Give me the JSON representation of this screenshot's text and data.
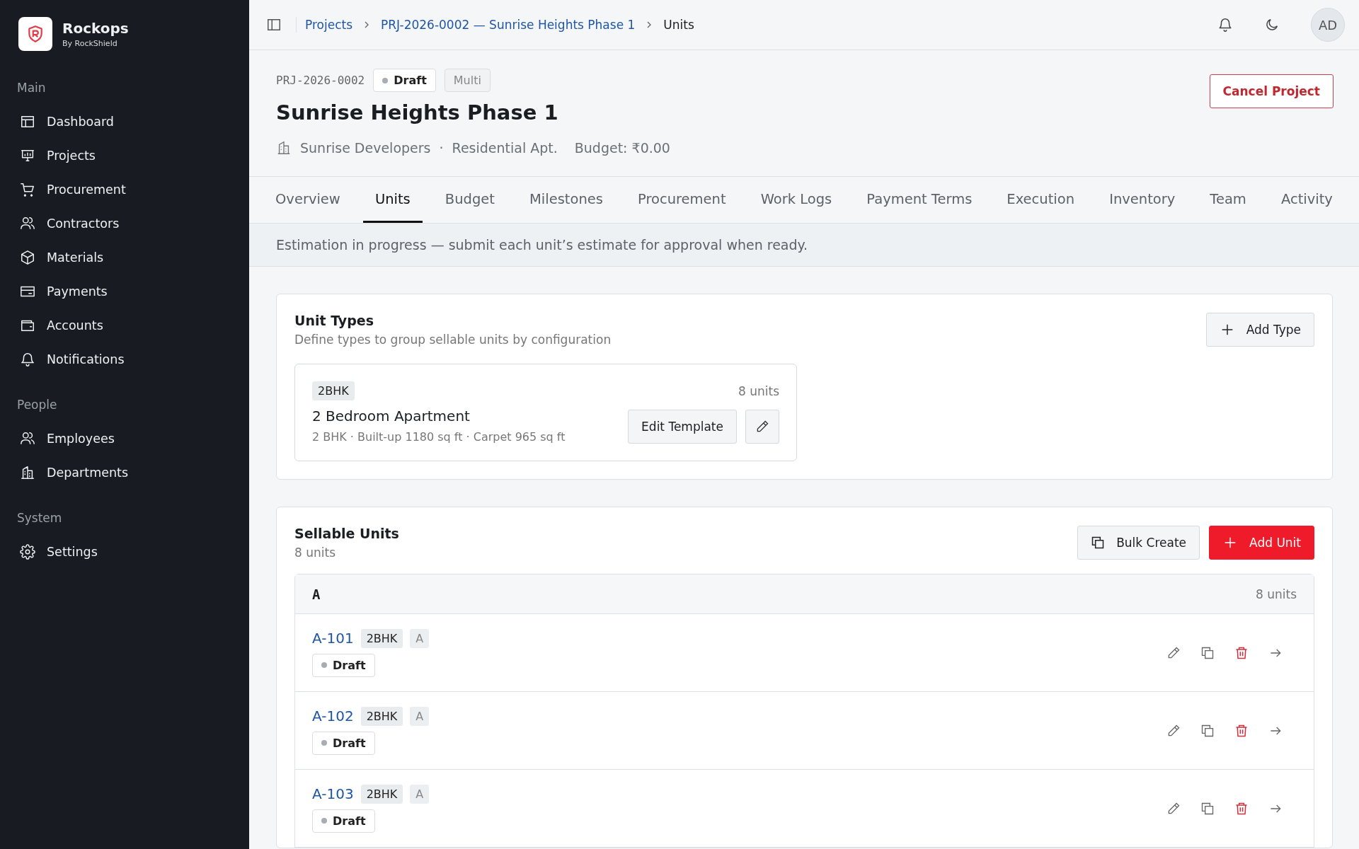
{
  "brand": {
    "name": "Rockops",
    "tagline": "By RockShield"
  },
  "sidebar": {
    "sections": [
      {
        "heading": "Main",
        "items": [
          {
            "label": "Dashboard",
            "selected": false
          },
          {
            "label": "Projects",
            "selected": false
          },
          {
            "label": "Procurement",
            "selected": false
          },
          {
            "label": "Contractors",
            "selected": false
          },
          {
            "label": "Materials",
            "selected": false
          },
          {
            "label": "Payments",
            "selected": false
          },
          {
            "label": "Accounts",
            "selected": false
          },
          {
            "label": "Notifications",
            "selected": false
          }
        ]
      },
      {
        "heading": "People",
        "items": [
          {
            "label": "Employees",
            "selected": false
          },
          {
            "label": "Departments",
            "selected": false
          }
        ]
      },
      {
        "heading": "System",
        "items": [
          {
            "label": "Settings",
            "selected": false
          }
        ]
      }
    ]
  },
  "breadcrumbs": [
    {
      "label": "Projects",
      "kind": "link"
    },
    {
      "label": "PRJ-2026-0002 — Sunrise Heights Phase 1",
      "kind": "link"
    },
    {
      "label": "Units",
      "kind": "current"
    }
  ],
  "user": {
    "initials": "AD"
  },
  "project": {
    "code": "PRJ-2026-0002",
    "status": "Draft",
    "type": "Multi",
    "title": "Sunrise Heights Phase 1",
    "developer": "Sunrise Developers",
    "separator": "·",
    "category": "Residential Apt.",
    "budget": "Budget: ₹0.00",
    "action": "Cancel Project"
  },
  "tabs": [
    {
      "label": "Overview",
      "selected": false
    },
    {
      "label": "Units",
      "selected": true
    },
    {
      "label": "Budget",
      "selected": false
    },
    {
      "label": "Milestones",
      "selected": false
    },
    {
      "label": "Procurement",
      "selected": false
    },
    {
      "label": "Work Logs",
      "selected": false
    },
    {
      "label": "Payment Terms",
      "selected": false
    },
    {
      "label": "Execution",
      "selected": false
    },
    {
      "label": "Inventory",
      "selected": false
    },
    {
      "label": "Team",
      "selected": false
    },
    {
      "label": "Activity",
      "selected": false
    }
  ],
  "banner": "Estimation in progress — submit each unit’s estimate for approval when ready.",
  "unit_types": {
    "title": "Unit Types",
    "subtitle": "Define types to group sellable units by configuration",
    "add_button": "Add Type",
    "types": [
      {
        "code": "2BHK",
        "count": "8 units",
        "name": "2 Bedroom Apartment",
        "details": "2 BHK · Built-up 1180 sq ft · Carpet 965 sq ft",
        "template_button": "Edit Template"
      }
    ]
  },
  "sellable_units": {
    "title": "Sellable Units",
    "count": "8 units",
    "bulk_button": "Bulk Create",
    "add_button": "Add Unit",
    "groups": [
      {
        "name": "A",
        "count": "8 units",
        "units": [
          {
            "id": "A-101",
            "type": "2BHK",
            "block": "A",
            "status": "Draft"
          },
          {
            "id": "A-102",
            "type": "2BHK",
            "block": "A",
            "status": "Draft"
          },
          {
            "id": "A-103",
            "type": "2BHK",
            "block": "A",
            "status": "Draft"
          }
        ]
      }
    ]
  }
}
